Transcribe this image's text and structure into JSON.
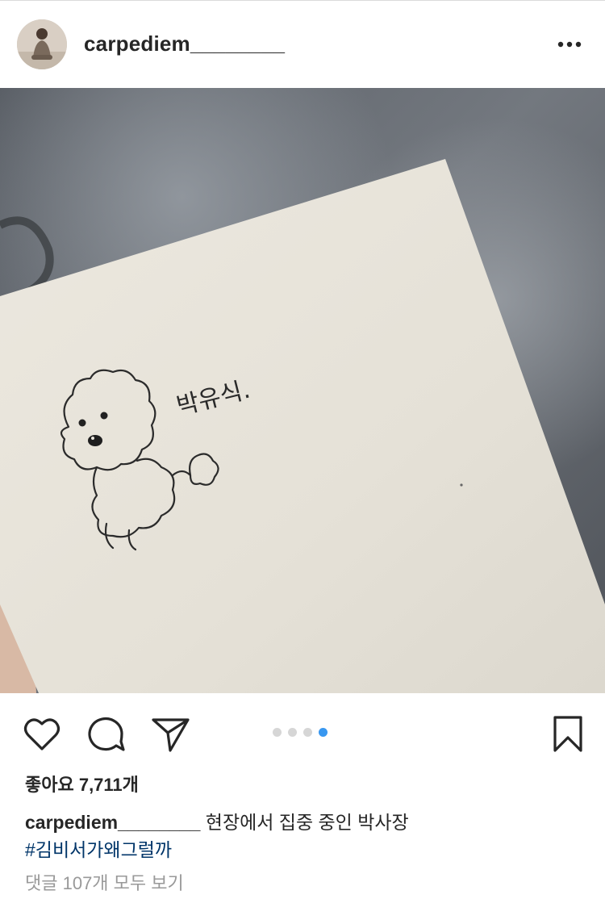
{
  "post": {
    "author": {
      "username": "carpediem________",
      "avatar_icon": "user-avatar"
    },
    "more_icon": "more-horizontal-icon",
    "image": {
      "handwritten_text": "박유식.",
      "drawing": "poodle-dog-sketch"
    },
    "actions": {
      "like_icon": "heart-icon",
      "comment_icon": "comment-bubble-icon",
      "share_icon": "paper-plane-icon",
      "save_icon": "bookmark-icon"
    },
    "carousel": {
      "total": 4,
      "active_index": 3,
      "active_color": "#3897f0",
      "inactive_color": "#d6d6d6"
    },
    "likes_text": "좋아요 7,711개",
    "caption": {
      "username": "carpediem________",
      "text": "현장에서 집중 중인 박사장"
    },
    "hashtag": "#김비서가왜그럴까",
    "comments_link": "댓글 107개 모두 보기"
  }
}
